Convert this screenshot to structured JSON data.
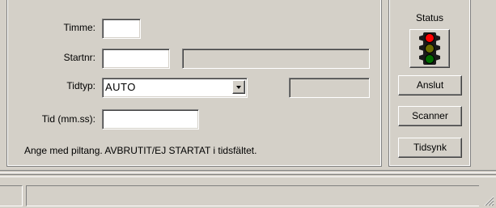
{
  "form": {
    "timme_label": "Timme:",
    "timme_value": "",
    "startnr_label": "Startnr:",
    "startnr_value": "",
    "startnr_name": "",
    "tidtyp_label": "Tidtyp:",
    "tidtyp_value": "AUTO",
    "tidtyp_extra": "",
    "tid_label": "Tid (mm.ss):",
    "tid_value": "",
    "hint": "Ange med piltang. AVBRUTIT/EJ STARTAT i tidsfältet."
  },
  "status": {
    "title": "Status",
    "light_state": "red",
    "colors": {
      "red_on": "#ff0000",
      "yellow_off": "#6b6b00",
      "green_off": "#006b00"
    },
    "buttons": {
      "anslut": "Anslut",
      "scanner": "Scanner",
      "tidsynk": "Tidsynk"
    }
  },
  "statusbar": {
    "left_text": "",
    "main_text": ""
  },
  "icons": {
    "traffic_light": "traffic-light-icon",
    "dropdown": "chevron-down-icon",
    "resize_grip": "resize-grip-icon"
  }
}
